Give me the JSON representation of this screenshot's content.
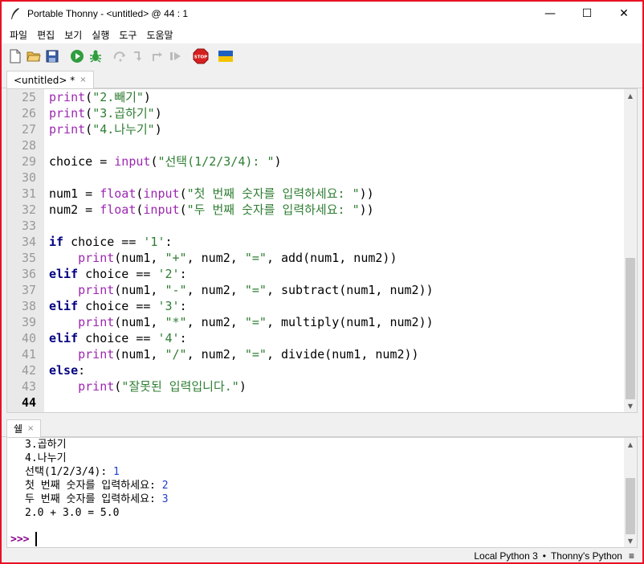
{
  "window": {
    "title": "Portable Thonny  -  <untitled>  @  44 : 1",
    "minimize": "—",
    "maximize": "☐",
    "close": "✕"
  },
  "menu": [
    "파일",
    "편집",
    "보기",
    "실행",
    "도구",
    "도움말"
  ],
  "toolbar": {
    "icons": [
      "new-file-icon",
      "open-file-icon",
      "save-icon",
      "run-icon",
      "debug-icon",
      "step-over-icon",
      "step-into-icon",
      "step-out-icon",
      "resume-icon",
      "stop-icon",
      "ukraine-flag-icon"
    ],
    "stop_label": "STOP"
  },
  "editor_tab": {
    "label": "<untitled>  *",
    "close": "×"
  },
  "editor": {
    "current_line": "44",
    "lines": [
      {
        "n": "25",
        "code": "print(\"2.빼기\")"
      },
      {
        "n": "26",
        "code": "print(\"3.곱하기\")"
      },
      {
        "n": "27",
        "code": "print(\"4.나누기\")"
      },
      {
        "n": "28",
        "code": ""
      },
      {
        "n": "29",
        "code": "choice = input(\"선택(1/2/3/4): \")"
      },
      {
        "n": "30",
        "code": ""
      },
      {
        "n": "31",
        "code": "num1 = float(input(\"첫 번째 숫자를 입력하세요: \"))"
      },
      {
        "n": "32",
        "code": "num2 = float(input(\"두 번째 숫자를 입력하세요: \"))"
      },
      {
        "n": "33",
        "code": ""
      },
      {
        "n": "34",
        "code": "if choice == '1':"
      },
      {
        "n": "35",
        "code": "    print(num1, \"+\", num2, \"=\", add(num1, num2))"
      },
      {
        "n": "36",
        "code": "elif choice == '2':"
      },
      {
        "n": "37",
        "code": "    print(num1, \"-\", num2, \"=\", subtract(num1, num2))"
      },
      {
        "n": "38",
        "code": "elif choice == '3':"
      },
      {
        "n": "39",
        "code": "    print(num1, \"*\", num2, \"=\", multiply(num1, num2))"
      },
      {
        "n": "40",
        "code": "elif choice == '4':"
      },
      {
        "n": "41",
        "code": "    print(num1, \"/\", num2, \"=\", divide(num1, num2))"
      },
      {
        "n": "42",
        "code": "else:"
      },
      {
        "n": "43",
        "code": "    print(\"잘못된 입력입니다.\")"
      },
      {
        "n": "44",
        "code": ""
      }
    ]
  },
  "shell_tab": {
    "label": "쉘",
    "close": "×"
  },
  "shell": {
    "lines": [
      {
        "text": "3.곱하기",
        "input": ""
      },
      {
        "text": "4.나누기",
        "input": ""
      },
      {
        "text": "선택(1/2/3/4): ",
        "input": "1"
      },
      {
        "text": "첫 번째 숫자를 입력하세요: ",
        "input": "2"
      },
      {
        "text": "두 번째 숫자를 입력하세요: ",
        "input": "3"
      },
      {
        "text": "2.0 + 3.0 = 5.0",
        "input": ""
      }
    ],
    "prompt": ">>>"
  },
  "status": {
    "interpreter": "Local Python 3",
    "separator": "•",
    "backend": "Thonny's Python",
    "menu_glyph": "≡"
  },
  "colors": {
    "keyword": "#000080",
    "builtin": "#9c27b0",
    "string": "#2e7d32",
    "shell_input": "#1e3ec9",
    "prompt": "#8b008b",
    "window_border": "#e81123"
  }
}
